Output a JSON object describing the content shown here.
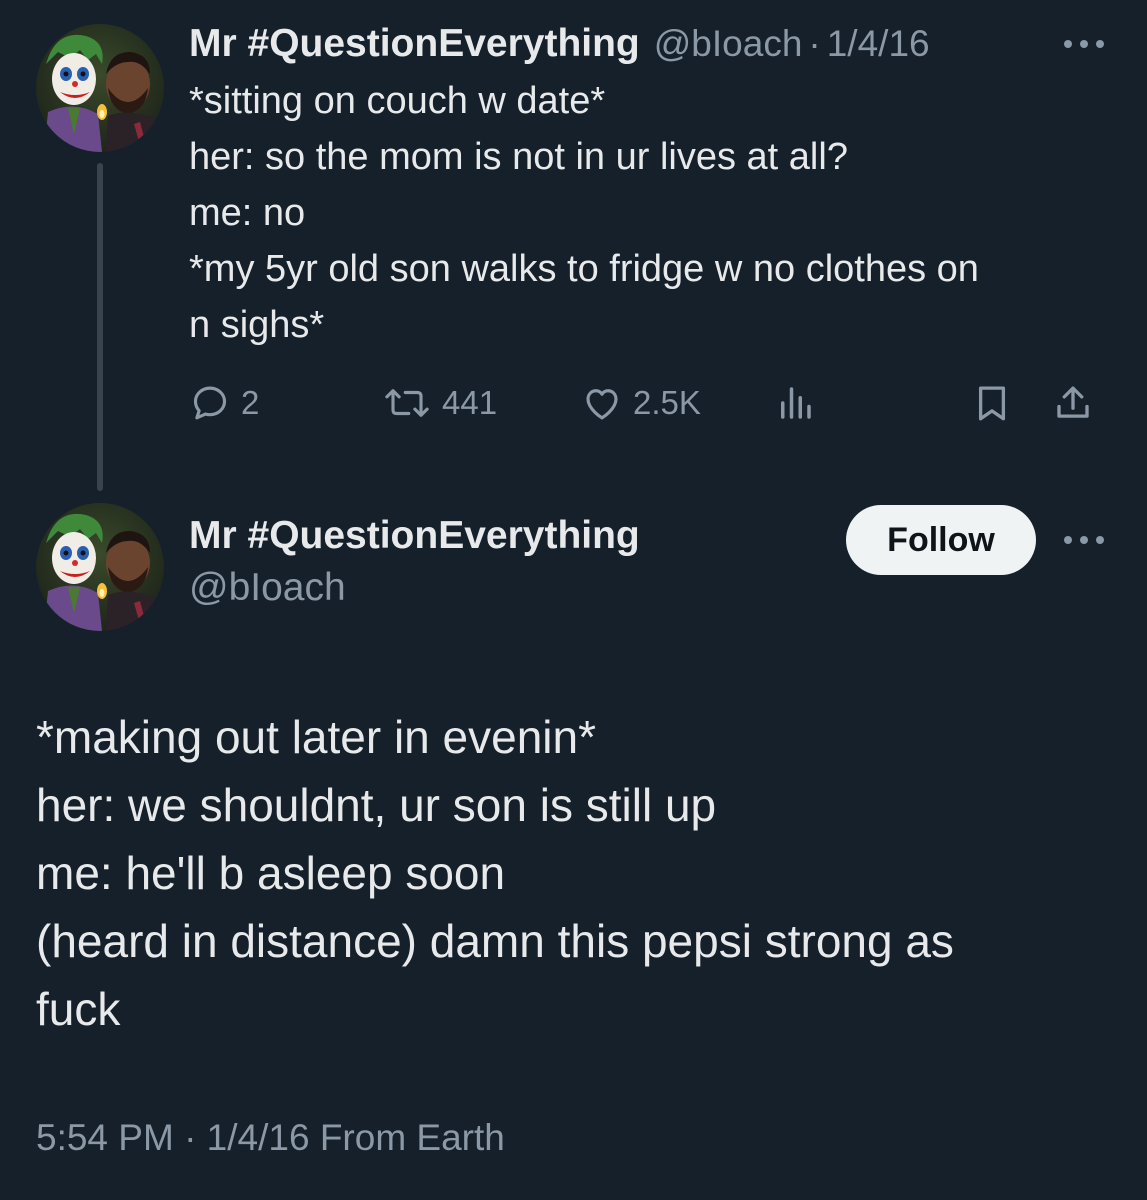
{
  "thread_tweet": {
    "display_name": "Mr #QuestionEverything",
    "handle": "@bIoach",
    "separator": "·",
    "date": "1/4/16",
    "lines": [
      "*sitting on couch w date*",
      "her: so the mom is not in ur lives at all?",
      "me: no",
      "*my 5yr old son walks to fridge w no clothes on",
      "n sighs*"
    ],
    "actions": {
      "replies": "2",
      "retweets": "441",
      "likes": "2.5K"
    }
  },
  "main_tweet": {
    "display_name": "Mr #QuestionEverything",
    "handle": "@bIoach",
    "follow_label": "Follow",
    "lines": [
      "*making out later in evenin*",
      "her: we shouldnt, ur son is still up",
      "me: he'll b asleep soon",
      "(heard in distance) damn this pepsi strong as",
      "fuck"
    ],
    "meta": "5:54 PM · 1/4/16 From Earth"
  },
  "icons": {
    "avatar": "avatar-joker-and-man-icon",
    "reply": "reply-icon",
    "retweet": "retweet-icon",
    "like": "heart-icon",
    "views": "views-icon",
    "bookmark": "bookmark-icon",
    "share": "share-icon",
    "more": "more-icon"
  },
  "colors": {
    "background": "#15202b",
    "text": "#e7e9ea",
    "secondary_text": "#8b98a5",
    "thread_line": "#38444d",
    "follow_bg": "#eff3f4",
    "follow_text": "#0f1419"
  }
}
